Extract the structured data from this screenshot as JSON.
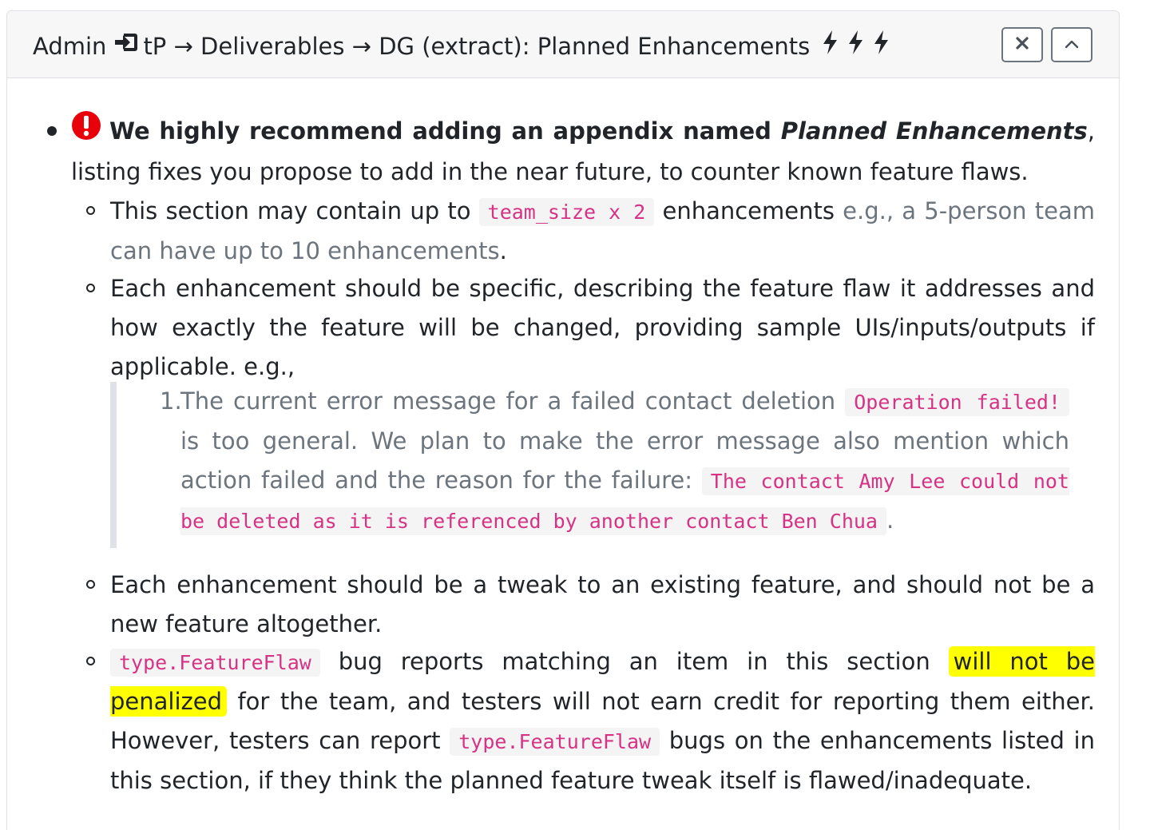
{
  "header": {
    "admin": "Admin",
    "tp": "tP",
    "arrow": "→",
    "deliverables": "Deliverables",
    "section": "DG (extract): Planned Enhancements",
    "icons": {
      "login": "login-icon",
      "bolt": "lightning-icon",
      "close": "close-icon",
      "collapse": "chevron-up-icon"
    }
  },
  "main": {
    "bold_lead": "We highly recommend adding an appendix named ",
    "bold_italic": "Planned Enhancements",
    "rest": ", listing fixes you propose to add in the near future, to counter known feature flaws.",
    "icon": "exclamation-circle-icon",
    "icon_color": "#e8000b"
  },
  "sub1": {
    "text_a": "This section may contain up to ",
    "code": "team_size x 2",
    "text_b": " enhancements ",
    "muted": "e.g., a 5-person team can have up to 10 enhancements",
    "text_c": "."
  },
  "sub2": {
    "text": "Each enhancement should be specific, describing the feature flaw it addresses and how exactly the feature will be changed, providing sample UIs/inputs/outputs if applicable. e.g.,"
  },
  "example": {
    "number": "1.",
    "text_a": "The current error message for a failed contact deletion ",
    "code_a": "Operation failed!",
    "text_b": " is too general. We plan to make the error message also mention which action failed and the reason for the failure: ",
    "code_b": "The contact Amy Lee could not be deleted as it is referenced by another contact Ben Chua",
    "text_c": "."
  },
  "sub3": {
    "text": "Each enhancement should be a tweak to an existing feature, and should not be a new feature altogether."
  },
  "sub4": {
    "code_a": "type.FeatureFlaw",
    "text_a": " bug reports matching an item in this section ",
    "highlight": "will not be penalized",
    "text_b": " for the team, and testers will not earn credit for reporting them either. However, testers can report ",
    "code_b": "type.FeatureFlaw",
    "text_c": " bugs on the enhancements listed in this section, if they think the planned feature tweak itself is flawed/inadequate."
  },
  "colors": {
    "code_text": "#d63384",
    "highlight": "#ffff00",
    "muted": "#6c757d"
  }
}
